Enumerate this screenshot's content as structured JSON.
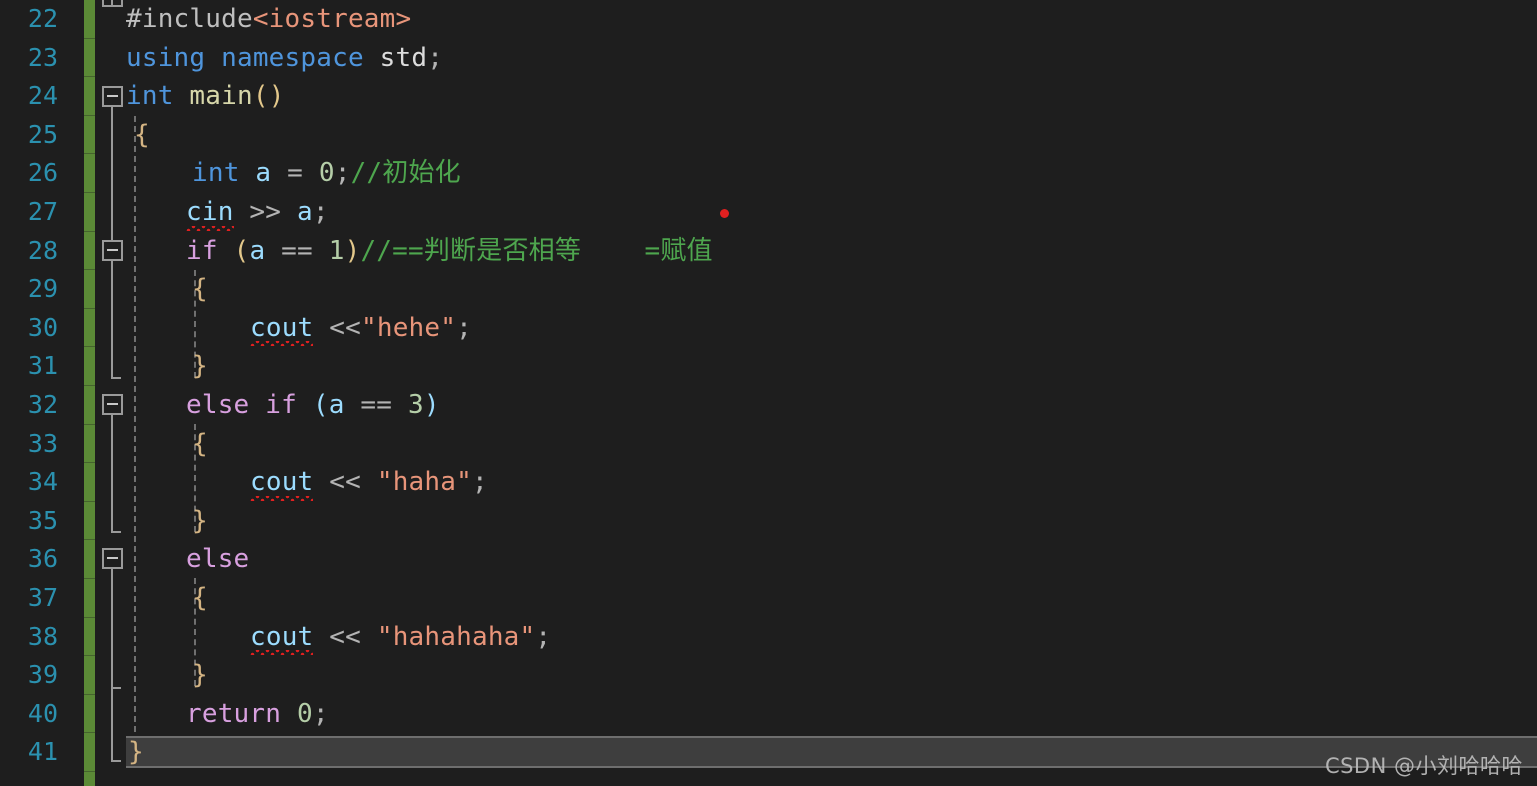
{
  "editor": {
    "background_color": "#1E1E1E",
    "line_number_color": "#2B91AF",
    "change_bar_color": "#5B8A36",
    "first_line": 22,
    "last_line": 41,
    "line_height_px": 38.6
  },
  "watermark": {
    "text": "CSDN @小刘哈哈哈"
  },
  "lines": [
    {
      "n": "22",
      "text": "#include<iostream>"
    },
    {
      "n": "23",
      "text": "using namespace std;"
    },
    {
      "n": "24",
      "text": "int main()"
    },
    {
      "n": "25",
      "text": "{"
    },
    {
      "n": "26",
      "text": "    int a = 0;//初始化"
    },
    {
      "n": "27",
      "text": "    cin >> a;"
    },
    {
      "n": "28",
      "text": "    if (a == 1)//==判断是否相等    =赋值"
    },
    {
      "n": "29",
      "text": "    {"
    },
    {
      "n": "30",
      "text": "        cout <<\"hehe\";"
    },
    {
      "n": "31",
      "text": "    }"
    },
    {
      "n": "32",
      "text": "    else if (a == 3)"
    },
    {
      "n": "33",
      "text": "    {"
    },
    {
      "n": "34",
      "text": "        cout << \"haha\";"
    },
    {
      "n": "35",
      "text": "    }"
    },
    {
      "n": "36",
      "text": "    else"
    },
    {
      "n": "37",
      "text": "    {"
    },
    {
      "n": "38",
      "text": "        cout << \"hahahaha\";"
    },
    {
      "n": "39",
      "text": "    }"
    },
    {
      "n": "40",
      "text": "    return 0;"
    },
    {
      "n": "41",
      "text": "}"
    }
  ],
  "tokens": {
    "l22": {
      "pp": "#include",
      "hdr": "<iostream>"
    },
    "l23": {
      "kw": "using namespace",
      "id": " std",
      "op": ";"
    },
    "l24": {
      "kw": "int",
      "fn": " main",
      "paren": "()"
    },
    "l25": {
      "brace": "{"
    },
    "l26": {
      "kw": "int",
      "id": " a ",
      "op1": "= ",
      "num": "0",
      "op2": ";",
      "cmt": "//初始化"
    },
    "l27": {
      "id": "cin",
      "op": " >> ",
      "id2": "a",
      "op2": ";"
    },
    "l28": {
      "kw": "if",
      "p1": " (",
      "id": "a",
      "op": " == ",
      "num": "1",
      "p2": ")",
      "cmt": "//==判断是否相等    =赋值"
    },
    "l29": {
      "brace": "{"
    },
    "l30": {
      "id": "cout",
      "op": " <<",
      "str": "\"hehe\"",
      "op2": ";"
    },
    "l31": {
      "brace": "}"
    },
    "l32": {
      "kw": "else if",
      "p1": " (",
      "id": "a",
      "op": " == ",
      "num": "3",
      "p2": ")"
    },
    "l33": {
      "brace": "{"
    },
    "l34": {
      "id": "cout",
      "op": " << ",
      "str": "\"haha\"",
      "op2": ";"
    },
    "l35": {
      "brace": "}"
    },
    "l36": {
      "kw": "else"
    },
    "l37": {
      "brace": "{"
    },
    "l38": {
      "id": "cout",
      "op": " << ",
      "str": "\"hahahaha\"",
      "op2": ";"
    },
    "l39": {
      "brace": "}"
    },
    "l40": {
      "kw": "return",
      "num": " 0",
      "op": ";"
    },
    "l41": {
      "brace": "}"
    }
  },
  "fold_markers": [
    {
      "line": "24",
      "state": "expanded"
    },
    {
      "line": "28",
      "state": "expanded"
    },
    {
      "line": "32",
      "state": "expanded"
    },
    {
      "line": "36",
      "state": "expanded"
    }
  ],
  "diagnostics": {
    "squiggle_color": "#E02020",
    "underlined_identifiers": [
      "cin",
      "cout",
      "cout",
      "cout"
    ]
  },
  "marker": {
    "red_dot_color": "#E02020"
  },
  "scrollbar": {
    "orientation": "horizontal",
    "track_color": "#3E3E3E"
  }
}
